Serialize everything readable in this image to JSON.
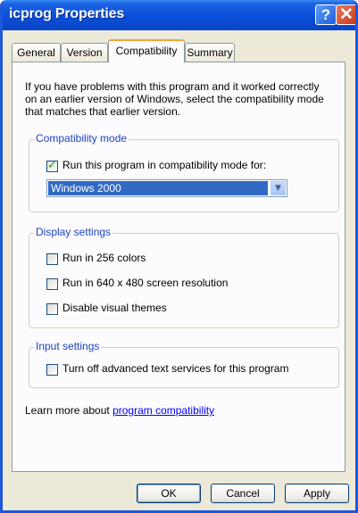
{
  "window": {
    "title": "icprog Properties",
    "help_label": "?",
    "close_label": "✕"
  },
  "tabs": [
    {
      "label": "General",
      "active": false
    },
    {
      "label": "Version",
      "active": false
    },
    {
      "label": "Compatibility",
      "active": true
    },
    {
      "label": "Summary",
      "active": false
    }
  ],
  "intro_text": "If you have problems with this program and it worked correctly on an earlier version of Windows, select the compatibility mode that matches that earlier version.",
  "compat": {
    "legend": "Compatibility mode",
    "checkbox_label": "Run this program in compatibility mode for:",
    "checked": true,
    "selected_os": "Windows 2000"
  },
  "display": {
    "legend": "Display settings",
    "opt_256": "Run in 256 colors",
    "opt_640": "Run in 640 x 480 screen resolution",
    "opt_themes": "Disable visual themes"
  },
  "input": {
    "legend": "Input settings",
    "opt_text": "Turn off advanced text services for this program"
  },
  "learn": {
    "prefix": "Learn more about ",
    "link": "program compatibility"
  },
  "buttons": {
    "ok": "OK",
    "cancel": "Cancel",
    "apply": "Apply"
  }
}
